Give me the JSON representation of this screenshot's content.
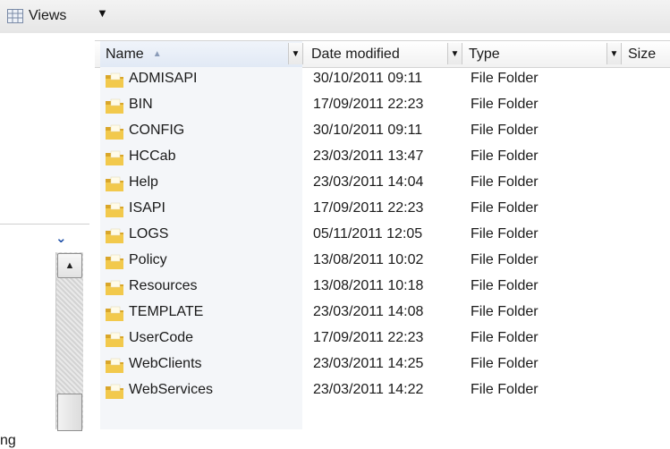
{
  "toolbar": {
    "views_label": "Views",
    "views_icon": "views-icon",
    "dropdown_icon": "chevron-down-icon"
  },
  "nav": {
    "chevron_icon": "chevron-down-icon",
    "partial_text": "ng"
  },
  "columns": {
    "name": "Name",
    "date": "Date modified",
    "type": "Type",
    "size": "Size"
  },
  "files": [
    {
      "name": "ADMISAPI",
      "date": "30/10/2011 09:11",
      "type": "File Folder"
    },
    {
      "name": "BIN",
      "date": "17/09/2011 22:23",
      "type": "File Folder"
    },
    {
      "name": "CONFIG",
      "date": "30/10/2011 09:11",
      "type": "File Folder"
    },
    {
      "name": "HCCab",
      "date": "23/03/2011 13:47",
      "type": "File Folder"
    },
    {
      "name": "Help",
      "date": "23/03/2011 14:04",
      "type": "File Folder"
    },
    {
      "name": "ISAPI",
      "date": "17/09/2011 22:23",
      "type": "File Folder"
    },
    {
      "name": "LOGS",
      "date": "05/11/2011 12:05",
      "type": "File Folder"
    },
    {
      "name": "Policy",
      "date": "13/08/2011 10:02",
      "type": "File Folder"
    },
    {
      "name": "Resources",
      "date": "13/08/2011 10:18",
      "type": "File Folder"
    },
    {
      "name": "TEMPLATE",
      "date": "23/03/2011 14:08",
      "type": "File Folder"
    },
    {
      "name": "UserCode",
      "date": "17/09/2011 22:23",
      "type": "File Folder"
    },
    {
      "name": "WebClients",
      "date": "23/03/2011 14:25",
      "type": "File Folder"
    },
    {
      "name": "WebServices",
      "date": "23/03/2011 14:22",
      "type": "File Folder"
    }
  ],
  "colors": {
    "folder": "#f2c94c",
    "folder_dark": "#d9a62a",
    "header_sorted": "#e1e9f5",
    "accent": "#1e4fa8"
  }
}
